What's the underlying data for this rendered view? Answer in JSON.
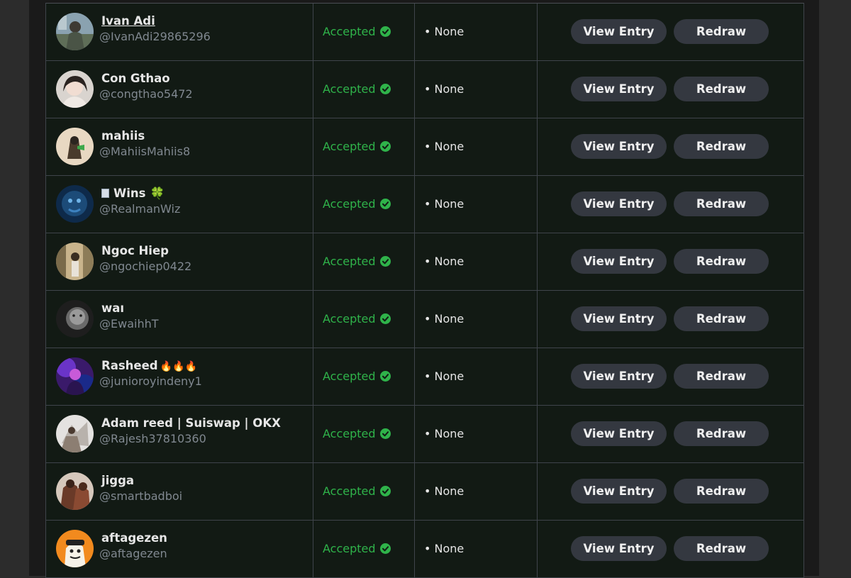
{
  "colors": {
    "accepted": "#2fb34a",
    "button_bg": "#343840",
    "row_bg": "#121a14"
  },
  "entries": [
    {
      "display_name": "Ivan Adi",
      "handle": "@IvanAdi29865296",
      "status": "Accepted",
      "bonus": "• None",
      "view_label": "View Entry",
      "redraw_label": "Redraw"
    },
    {
      "display_name": "Con Gthao",
      "handle": "@congthao5472",
      "status": "Accepted",
      "bonus": "• None",
      "view_label": "View Entry",
      "redraw_label": "Redraw"
    },
    {
      "display_name": "mahiis",
      "handle": "@MahiisMahiis8",
      "status": "Accepted",
      "bonus": "• None",
      "view_label": "View Entry",
      "redraw_label": "Redraw"
    },
    {
      "display_name": "Wins",
      "handle": "@RealmanWiz",
      "status": "Accepted",
      "bonus": "• None",
      "view_label": "View Entry",
      "redraw_label": "Redraw",
      "prefix_emoji": "abacus-emoji",
      "suffix": "🍀"
    },
    {
      "display_name": "Ngoc Hiep",
      "handle": "@ngochiep0422",
      "status": "Accepted",
      "bonus": "• None",
      "view_label": "View Entry",
      "redraw_label": "Redraw"
    },
    {
      "display_name": "waı",
      "handle": "@EwaihhT",
      "status": "Accepted",
      "bonus": "• None",
      "view_label": "View Entry",
      "redraw_label": "Redraw"
    },
    {
      "display_name": "Rasheed",
      "handle": "@junioroyindeny1",
      "status": "Accepted",
      "bonus": "• None",
      "view_label": "View Entry",
      "redraw_label": "Redraw",
      "suffix": "🔥🔥🔥"
    },
    {
      "display_name": "Adam reed | Suiswap | OKX",
      "handle": "@Rajesh37810360",
      "status": "Accepted",
      "bonus": "• None",
      "view_label": "View Entry",
      "redraw_label": "Redraw"
    },
    {
      "display_name": "jigga",
      "handle": "@smartbadboi",
      "status": "Accepted",
      "bonus": "• None",
      "view_label": "View Entry",
      "redraw_label": "Redraw"
    },
    {
      "display_name": "aftagezen",
      "handle": "@aftagezen",
      "status": "Accepted",
      "bonus": "• None",
      "view_label": "View Entry",
      "redraw_label": "Redraw"
    }
  ]
}
